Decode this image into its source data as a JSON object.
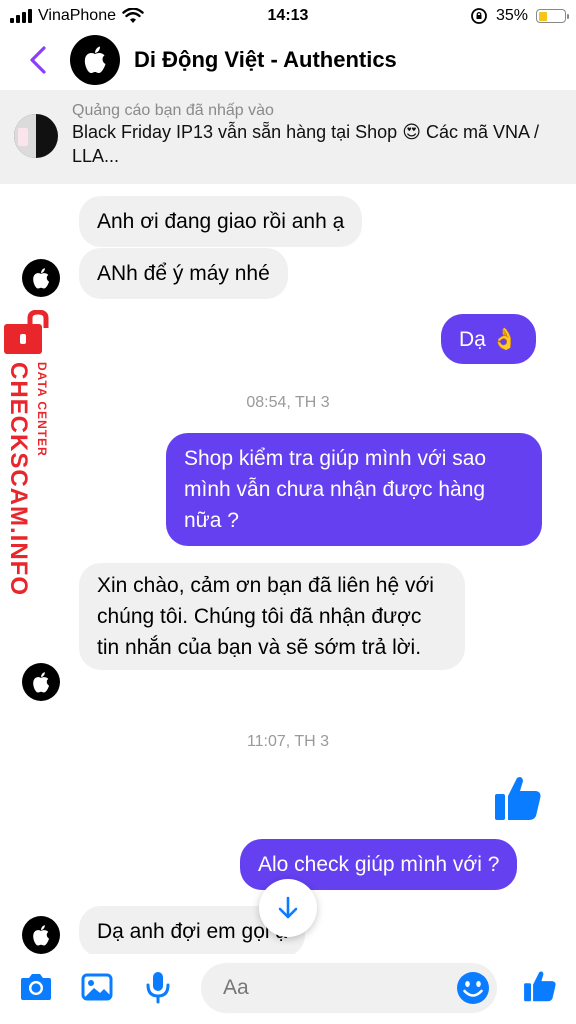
{
  "status_bar": {
    "carrier": "VinaPhone",
    "time": "14:13",
    "battery_percent": "35%",
    "battery_level": 0.35,
    "icons": [
      "signal-icon",
      "wifi-icon",
      "orientation-lock-icon",
      "battery-icon"
    ]
  },
  "header": {
    "title": "Di Động Việt - Authentics",
    "back_icon": "chevron-left-icon",
    "avatar_icon": "apple-logo-icon"
  },
  "ad_banner": {
    "label": "Quảng cáo bạn đã nhấp vào",
    "text": "Black Friday IP13 vẫn sẵn hàng tại Shop 😍 Các mã VNA / LLA..."
  },
  "watermark": {
    "main": "CHECKSCAM.INFO",
    "sub": "DATA CENTER"
  },
  "messages": {
    "m1": "Anh ơi đang giao rồi anh ạ",
    "m2": "ANh để ý máy nhé",
    "m3": "Dạ 👌",
    "ts1": "08:54, TH 3",
    "m4": "Shop kiểm tra giúp mình với sao mình vẫn chưa nhận được hàng nữa ?",
    "m5": "Xin chào, cảm ơn bạn đã liên hệ với chúng tôi. Chúng tôi đã nhận được tin nhắn của bạn và sẽ sớm trả lời.",
    "ts2": "11:07, TH 3",
    "m6": "Alo check giúp mình với ?",
    "m7": "Dạ anh đợi em gọi ạ"
  },
  "composer": {
    "placeholder": "Aa",
    "icons": [
      "camera-icon",
      "photo-icon",
      "microphone-icon",
      "emoji-icon",
      "thumbs-up-icon"
    ]
  },
  "colors": {
    "outgoing_bubble": "#6540f0",
    "incoming_bubble": "#f0f0f0",
    "accent": "#8a3ffc",
    "messenger_blue": "#0a7cff",
    "watermark_red": "#e8262c"
  }
}
